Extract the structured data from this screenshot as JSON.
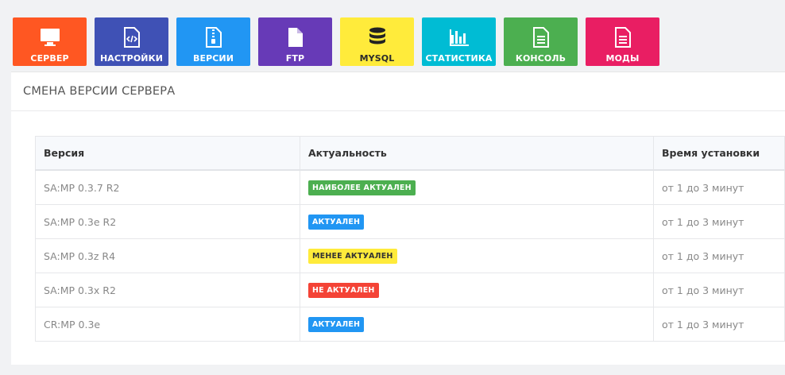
{
  "nav": {
    "items": [
      {
        "label": "СЕРВЕР",
        "icon": "monitor-icon",
        "color": "#ff5722"
      },
      {
        "label": "НАСТРОЙКИ",
        "icon": "code-file-icon",
        "color": "#3f51b5"
      },
      {
        "label": "ВЕРСИИ",
        "icon": "archive-file-icon",
        "color": "#2196f3"
      },
      {
        "label": "FTP",
        "icon": "file-icon",
        "color": "#673ab7"
      },
      {
        "label": "MYSQL",
        "icon": "database-icon",
        "color": "#ffeb3b"
      },
      {
        "label": "СТАТИСТИКА",
        "icon": "bar-chart-icon",
        "color": "#00bcd4"
      },
      {
        "label": "КОНСОЛЬ",
        "icon": "document-icon",
        "color": "#4caf50"
      },
      {
        "label": "МОДЫ",
        "icon": "document-icon",
        "color": "#e91e63"
      }
    ]
  },
  "panel": {
    "title": "СМЕНА ВЕРСИИ СЕРВЕРА",
    "table": {
      "headers": [
        "Версия",
        "Актуальность",
        "Время установки"
      ],
      "rows": [
        {
          "version": "SA:MP 0.3.7 R2",
          "status": "НАИБОЛЕЕ АКТУАЛЕН",
          "status_color": "#4caf50",
          "time": "от 1 до 3 минут"
        },
        {
          "version": "SA:MP 0.3e R2",
          "status": "АКТУАЛЕН",
          "status_color": "#2196f3",
          "time": "от 1 до 3 минут"
        },
        {
          "version": "SA:MP 0.3z R4",
          "status": "МЕНЕЕ АКТУАЛЕН",
          "status_color": "#ffeb3b",
          "time": "от 1 до 3 минут"
        },
        {
          "version": "SA:MP 0.3x R2",
          "status": "НЕ АКТУАЛЕН",
          "status_color": "#f44336",
          "time": "от 1 до 3 минут"
        },
        {
          "version": "CR:MP 0.3e",
          "status": "АКТУАЛЕН",
          "status_color": "#2196f3",
          "time": "от 1 до 3 минут"
        }
      ]
    }
  }
}
